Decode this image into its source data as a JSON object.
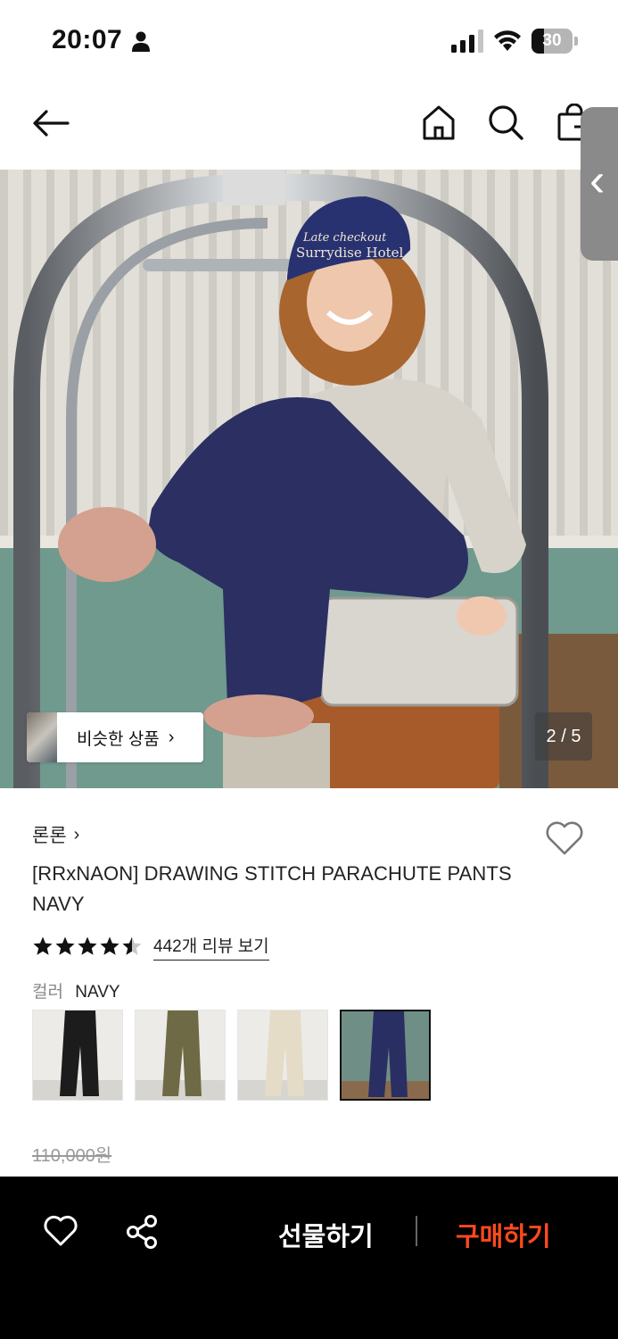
{
  "status_bar": {
    "time": "20:07",
    "battery": "30",
    "battery_level": 0.3
  },
  "nav": {
    "back": "back",
    "home": "home",
    "search": "search",
    "bag": "bag"
  },
  "icons": [
    "person-icon",
    "signal-icon",
    "wifi-icon",
    "battery-icon",
    "arrow-left-icon",
    "home-icon",
    "search-icon",
    "shopping-bag-icon",
    "chevron-left-icon",
    "heart-icon",
    "star-icon",
    "share-icon"
  ],
  "hero": {
    "similar_label": "비슷한 상품",
    "similar_chevron": "›",
    "page_indicator": "2 / 5",
    "cap_text_1": "Late checkout",
    "cap_text_2": "Surrydise Hotel"
  },
  "product": {
    "brand": "론론",
    "brand_chevron": "›",
    "title": "[RRxNAON] DRAWING STITCH PARACHUTE PANTS NAVY",
    "rating": 4.5,
    "review_link": "442개 리뷰 보기",
    "color_label": "컬러",
    "color_value": "NAVY",
    "swatches": [
      {
        "name": "black",
        "color": "#1c1c1c"
      },
      {
        "name": "khaki",
        "color": "#6e6a45"
      },
      {
        "name": "ivory",
        "color": "#e4dcc6"
      },
      {
        "name": "navy",
        "color": "#2a2f63",
        "selected": true
      }
    ],
    "original_price": "110,000원"
  },
  "bottom_bar": {
    "gift_label": "선물하기",
    "buy_label": "구매하기",
    "buy_color": "#ff4a1c"
  },
  "side_handle": "‹"
}
